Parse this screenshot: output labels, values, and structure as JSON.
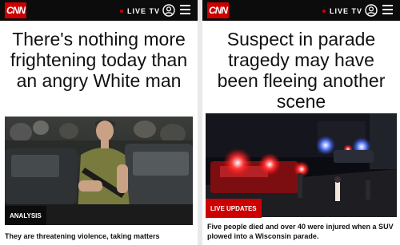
{
  "left": {
    "logo": "CNN",
    "live_label": "LIVE TV",
    "headline": "There's nothing more frightening today than an angry White man",
    "badge": "ANALYSIS",
    "teaser": "They are threatening violence, taking matters"
  },
  "right": {
    "logo": "CNN",
    "live_label": "LIVE TV",
    "headline": "Suspect in parade tragedy may have been fleeing another scene",
    "badge": "LIVE UPDATES",
    "teaser": "Five people died and over 40 were injured when a SUV plowed into a Wisconsin parade."
  },
  "colors": {
    "brand_red": "#cc0000",
    "header_bg": "#0c0c0c",
    "badge_dark": "#0c0c0c"
  },
  "icons": {
    "account": "account-circle-icon",
    "menu": "hamburger-menu-icon"
  }
}
